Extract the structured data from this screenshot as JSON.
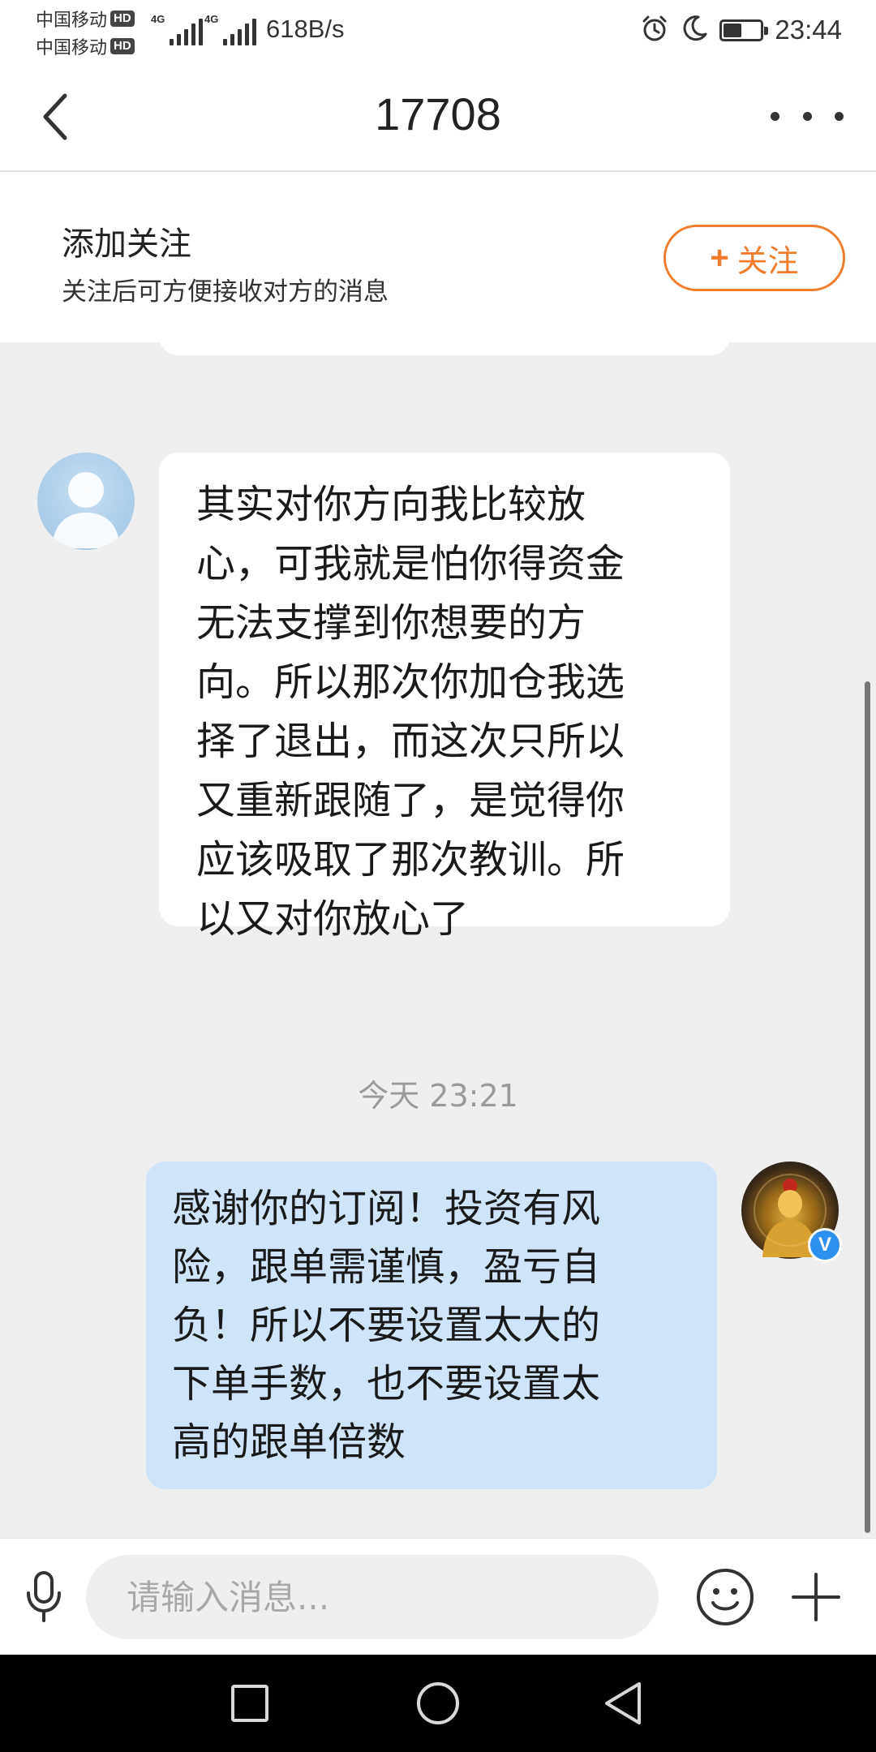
{
  "status_bar": {
    "carriers": [
      {
        "name": "中国移动",
        "badge": "HD"
      },
      {
        "name": "中国移动",
        "badge": "HD"
      }
    ],
    "network": [
      "4G",
      "4G"
    ],
    "speed": "618B/s",
    "battery_level": 0.45,
    "time": "23:44",
    "icons": [
      "alarm-icon",
      "moon-icon",
      "battery-icon"
    ]
  },
  "header": {
    "title": "17708",
    "back_icon": "chevron-left-icon",
    "more_icon": "more-dots-icon"
  },
  "follow_panel": {
    "title": "添加关注",
    "description": "关注后可方便接收对方的消息",
    "button_plus": "+",
    "button_label": "关注",
    "accent_color": "#ef7d2d"
  },
  "messages": [
    {
      "side": "left",
      "avatar": "default-user-avatar",
      "text": "其实对你方向我比较放\n心，可我就是怕你得资金\n无法支撑到你想要的方\n向。所以那次你加仓我选\n择了退出，而这次只所以\n又重新跟随了，是觉得你\n应该吸取了那次教训。所\n以又对你放心了"
    },
    {
      "side": "right",
      "avatar": "buddha-avatar",
      "verified_badge": "V",
      "bubble_color": "#cfe3f9",
      "text": "感谢你的订阅！投资有风\n险，跟单需谨慎，盈亏自\n负！所以不要设置太大的\n下单手数，也不要设置太\n高的跟单倍数"
    }
  ],
  "timestamp": "今天 23:21",
  "input_bar": {
    "placeholder": "请输入消息...",
    "icons": [
      "mic-icon",
      "emoji-icon",
      "plus-icon"
    ]
  },
  "nav_bar": {
    "icons": [
      "recent-apps-icon",
      "home-icon",
      "back-triangle-icon"
    ]
  }
}
